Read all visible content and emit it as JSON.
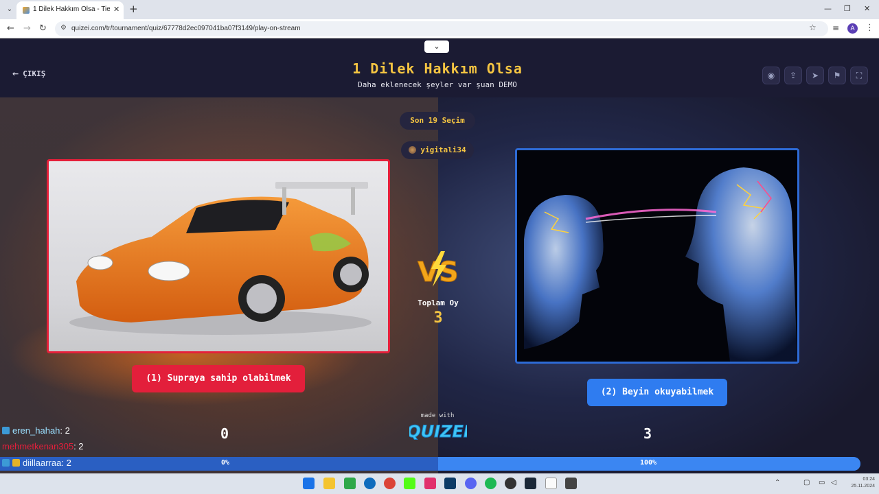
{
  "browser": {
    "tab_title": "1 Dilek Hakkım Olsa - Tier List, ",
    "tab_close": "✕",
    "new_tab": "+",
    "url": "quizei.com/tr/tournament/quiz/67778d2ec097041ba07f3149/play-on-stream",
    "profile_initial": "A"
  },
  "header": {
    "exit_label": "ÇIKIŞ",
    "title": "1 Dilek Hakkım Olsa",
    "subtitle": "Daha eklenecek şeyler var şuan DEMO"
  },
  "status": {
    "recent_picks": "Son 19 Seçim",
    "username": "yigitali34"
  },
  "choices": {
    "left_label": "(1) Supraya sahip olabilmek",
    "right_label": "(2) Beyin okuyabilmek",
    "left_image": "orange-sports-car",
    "right_image": "two-heads-brain-connection"
  },
  "totals": {
    "label": "Toplam Oy",
    "value": "3",
    "left_score": "0",
    "right_score": "3",
    "left_percent_label": "0%",
    "right_percent_label": "100%",
    "left_fraction": 0,
    "right_fraction": 1
  },
  "branding": {
    "made_with": "made with",
    "logo": "QUIZEI"
  },
  "chat": [
    {
      "user": "eren_hahah",
      "text": ": 2"
    },
    {
      "user": "mehmetkenan305",
      "text": ": 2"
    },
    {
      "user": "diillaarraa",
      "text": ": 2"
    }
  ],
  "taskbar": {
    "time": "03:24",
    "date": "25.11.2024"
  },
  "colors": {
    "accent_yellow": "#f5c542",
    "left_red": "#e31f3b",
    "right_blue": "#2f7cf0",
    "header_bg": "#1b1b33"
  }
}
